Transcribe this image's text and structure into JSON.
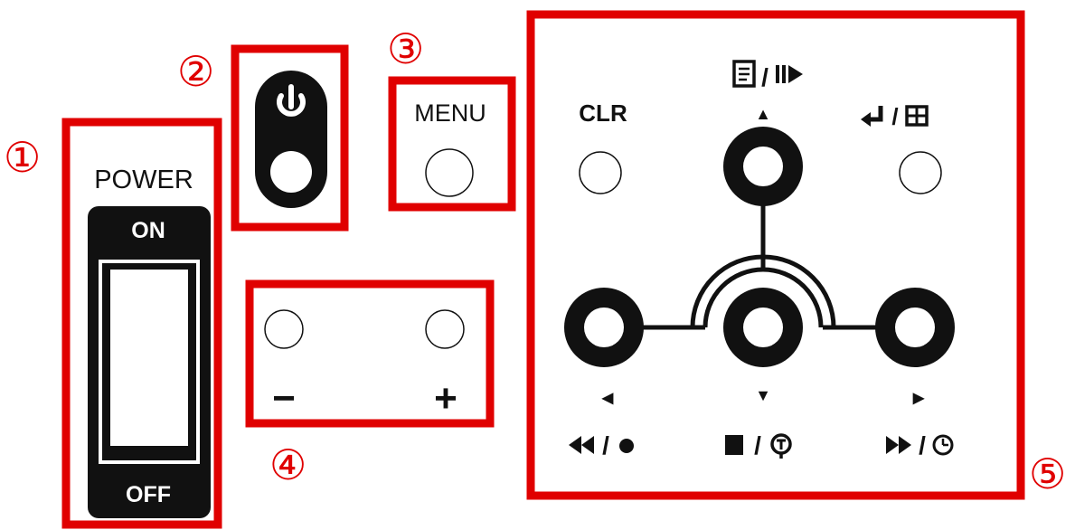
{
  "callouts": [
    "①",
    "②",
    "③",
    "④",
    "⑤"
  ],
  "power_switch": {
    "title": "POWER",
    "on_label": "ON",
    "off_label": "OFF"
  },
  "standby_button": {
    "icon": "power-symbol-icon"
  },
  "menu_button": {
    "label": "MENU"
  },
  "volume_buttons": {
    "minus_label": "−",
    "plus_label": "+"
  },
  "control_pad": {
    "clr_label": "CLR",
    "up_icons": [
      "document-icon",
      "play-pause-icon"
    ],
    "up_arrow": "▲",
    "enter_icons": [
      "return-arrow-icon",
      "grid-icon"
    ],
    "left_arrow": "◀",
    "down_arrow": "▼",
    "right_arrow": "▶",
    "left_icons": [
      "rewind-icon",
      "record-dot-icon"
    ],
    "down_icons": [
      "stop-square-icon",
      "timer-t-icon"
    ],
    "right_icons": [
      "fast-forward-icon",
      "clock-icon"
    ],
    "separator": "/"
  },
  "colors": {
    "highlight": "#e00000",
    "ink": "#111111",
    "background": "#ffffff"
  }
}
